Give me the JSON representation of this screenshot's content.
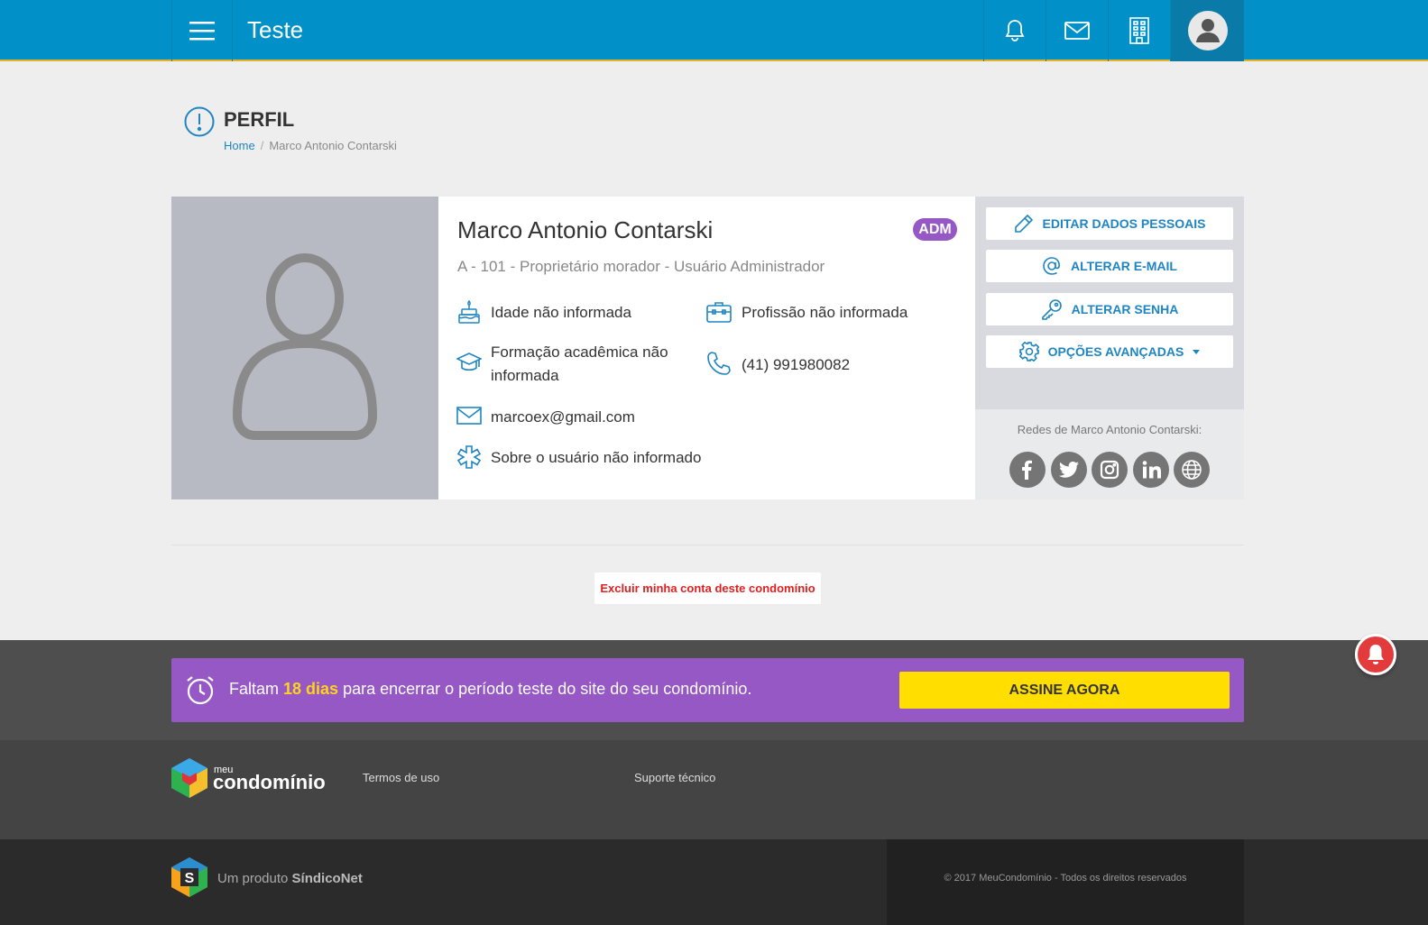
{
  "header": {
    "title": "Teste"
  },
  "page": {
    "title": "PERFIL",
    "breadcrumb": {
      "home": "Home",
      "separator": "/",
      "current": "Marco Antonio Contarski"
    }
  },
  "profile": {
    "name": "Marco Antonio Contarski",
    "badge": "ADM",
    "subtitle": "A - 101 - Proprietário morador - Usuário Administrador",
    "age": "Idade não informada",
    "profession": "Profissão não informada",
    "education": "Formação acadêmica não informada",
    "phone": "(41) 991980082",
    "email": "marcoex@gmail.com",
    "about": "Sobre o usuário não informado"
  },
  "actions": {
    "edit": "EDITAR DADOS PESSOAIS",
    "change_email": "ALTERAR E-MAIL",
    "change_password": "ALTERAR SENHA",
    "advanced": "OPÇÕES AVANÇADAS"
  },
  "social": {
    "title": "Redes de Marco Antonio Contarski:",
    "icons": [
      "facebook-icon",
      "twitter-icon",
      "instagram-icon",
      "linkedin-icon",
      "website-icon"
    ]
  },
  "delete_account": "Excluir minha conta deste condomínio",
  "trial": {
    "prefix": "Faltam ",
    "days": "18 dias",
    "suffix": " para encerrar o período teste do site do seu condomínio.",
    "button": "ASSINE AGORA"
  },
  "footer": {
    "logo_small": "meu",
    "logo_big": "condomínio",
    "terms": "Termos de uso",
    "support": "Suporte técnico",
    "product_prefix": "Um produto ",
    "product_name": "SíndicoNet",
    "copyright": "© 2017 MeuCondomínio - Todos os direitos reservados"
  },
  "colors": {
    "primary": "#0191c8",
    "accent_purple": "#9658c5",
    "link_blue": "#1f85c2",
    "cta_yellow": "#ffde00",
    "danger": "#e02020"
  }
}
